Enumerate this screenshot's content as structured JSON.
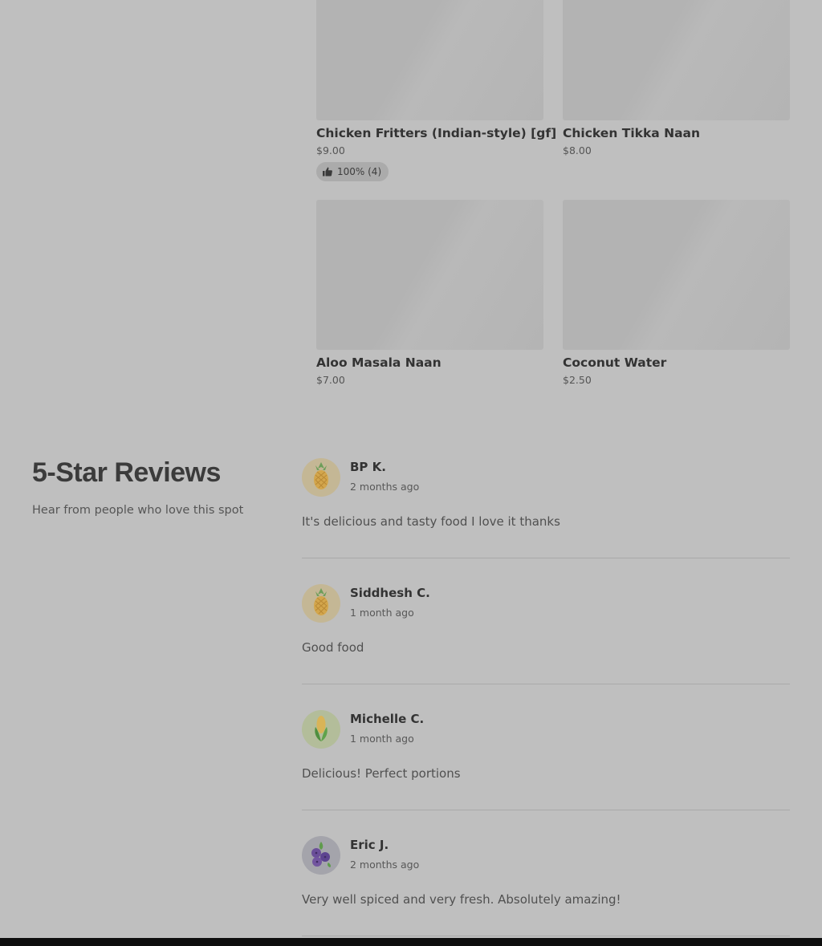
{
  "menu_items": [
    {
      "name": "Chicken Fritters (Indian-style) [gf]",
      "price": "$9.00",
      "rating": "100% (4)"
    },
    {
      "name": "Chicken Tikka Naan",
      "price": "$8.00"
    },
    {
      "name": "Aloo Masala Naan",
      "price": "$7.00"
    },
    {
      "name": "Coconut Water",
      "price": "$2.50"
    }
  ],
  "reviews_section": {
    "title": "5-Star Reviews",
    "subtitle": "Hear from people who love this spot"
  },
  "reviews": [
    {
      "author": "BP K.",
      "time": "2 months ago",
      "text": "It's delicious and tasty food I love it thanks",
      "avatar_icon": "pineapple-icon",
      "avatar_bg": "#c4b795"
    },
    {
      "author": "Siddhesh C.",
      "time": "1 month ago",
      "text": "Good food",
      "avatar_icon": "pineapple-icon",
      "avatar_bg": "#c4b795"
    },
    {
      "author": "Michelle C.",
      "time": "1 month ago",
      "text": "Delicious! Perfect portions",
      "avatar_icon": "corn-icon",
      "avatar_bg": "#b3bd9a"
    },
    {
      "author": "Eric J.",
      "time": "2 months ago",
      "text": "Very well spiced and very fresh. Absolutely amazing!",
      "avatar_icon": "blueberries-icon",
      "avatar_bg": "#a4a4ab"
    }
  ],
  "colors": {
    "overlay_bg": "#bfbfbf",
    "bottom_bar": "#0e0e0e"
  }
}
